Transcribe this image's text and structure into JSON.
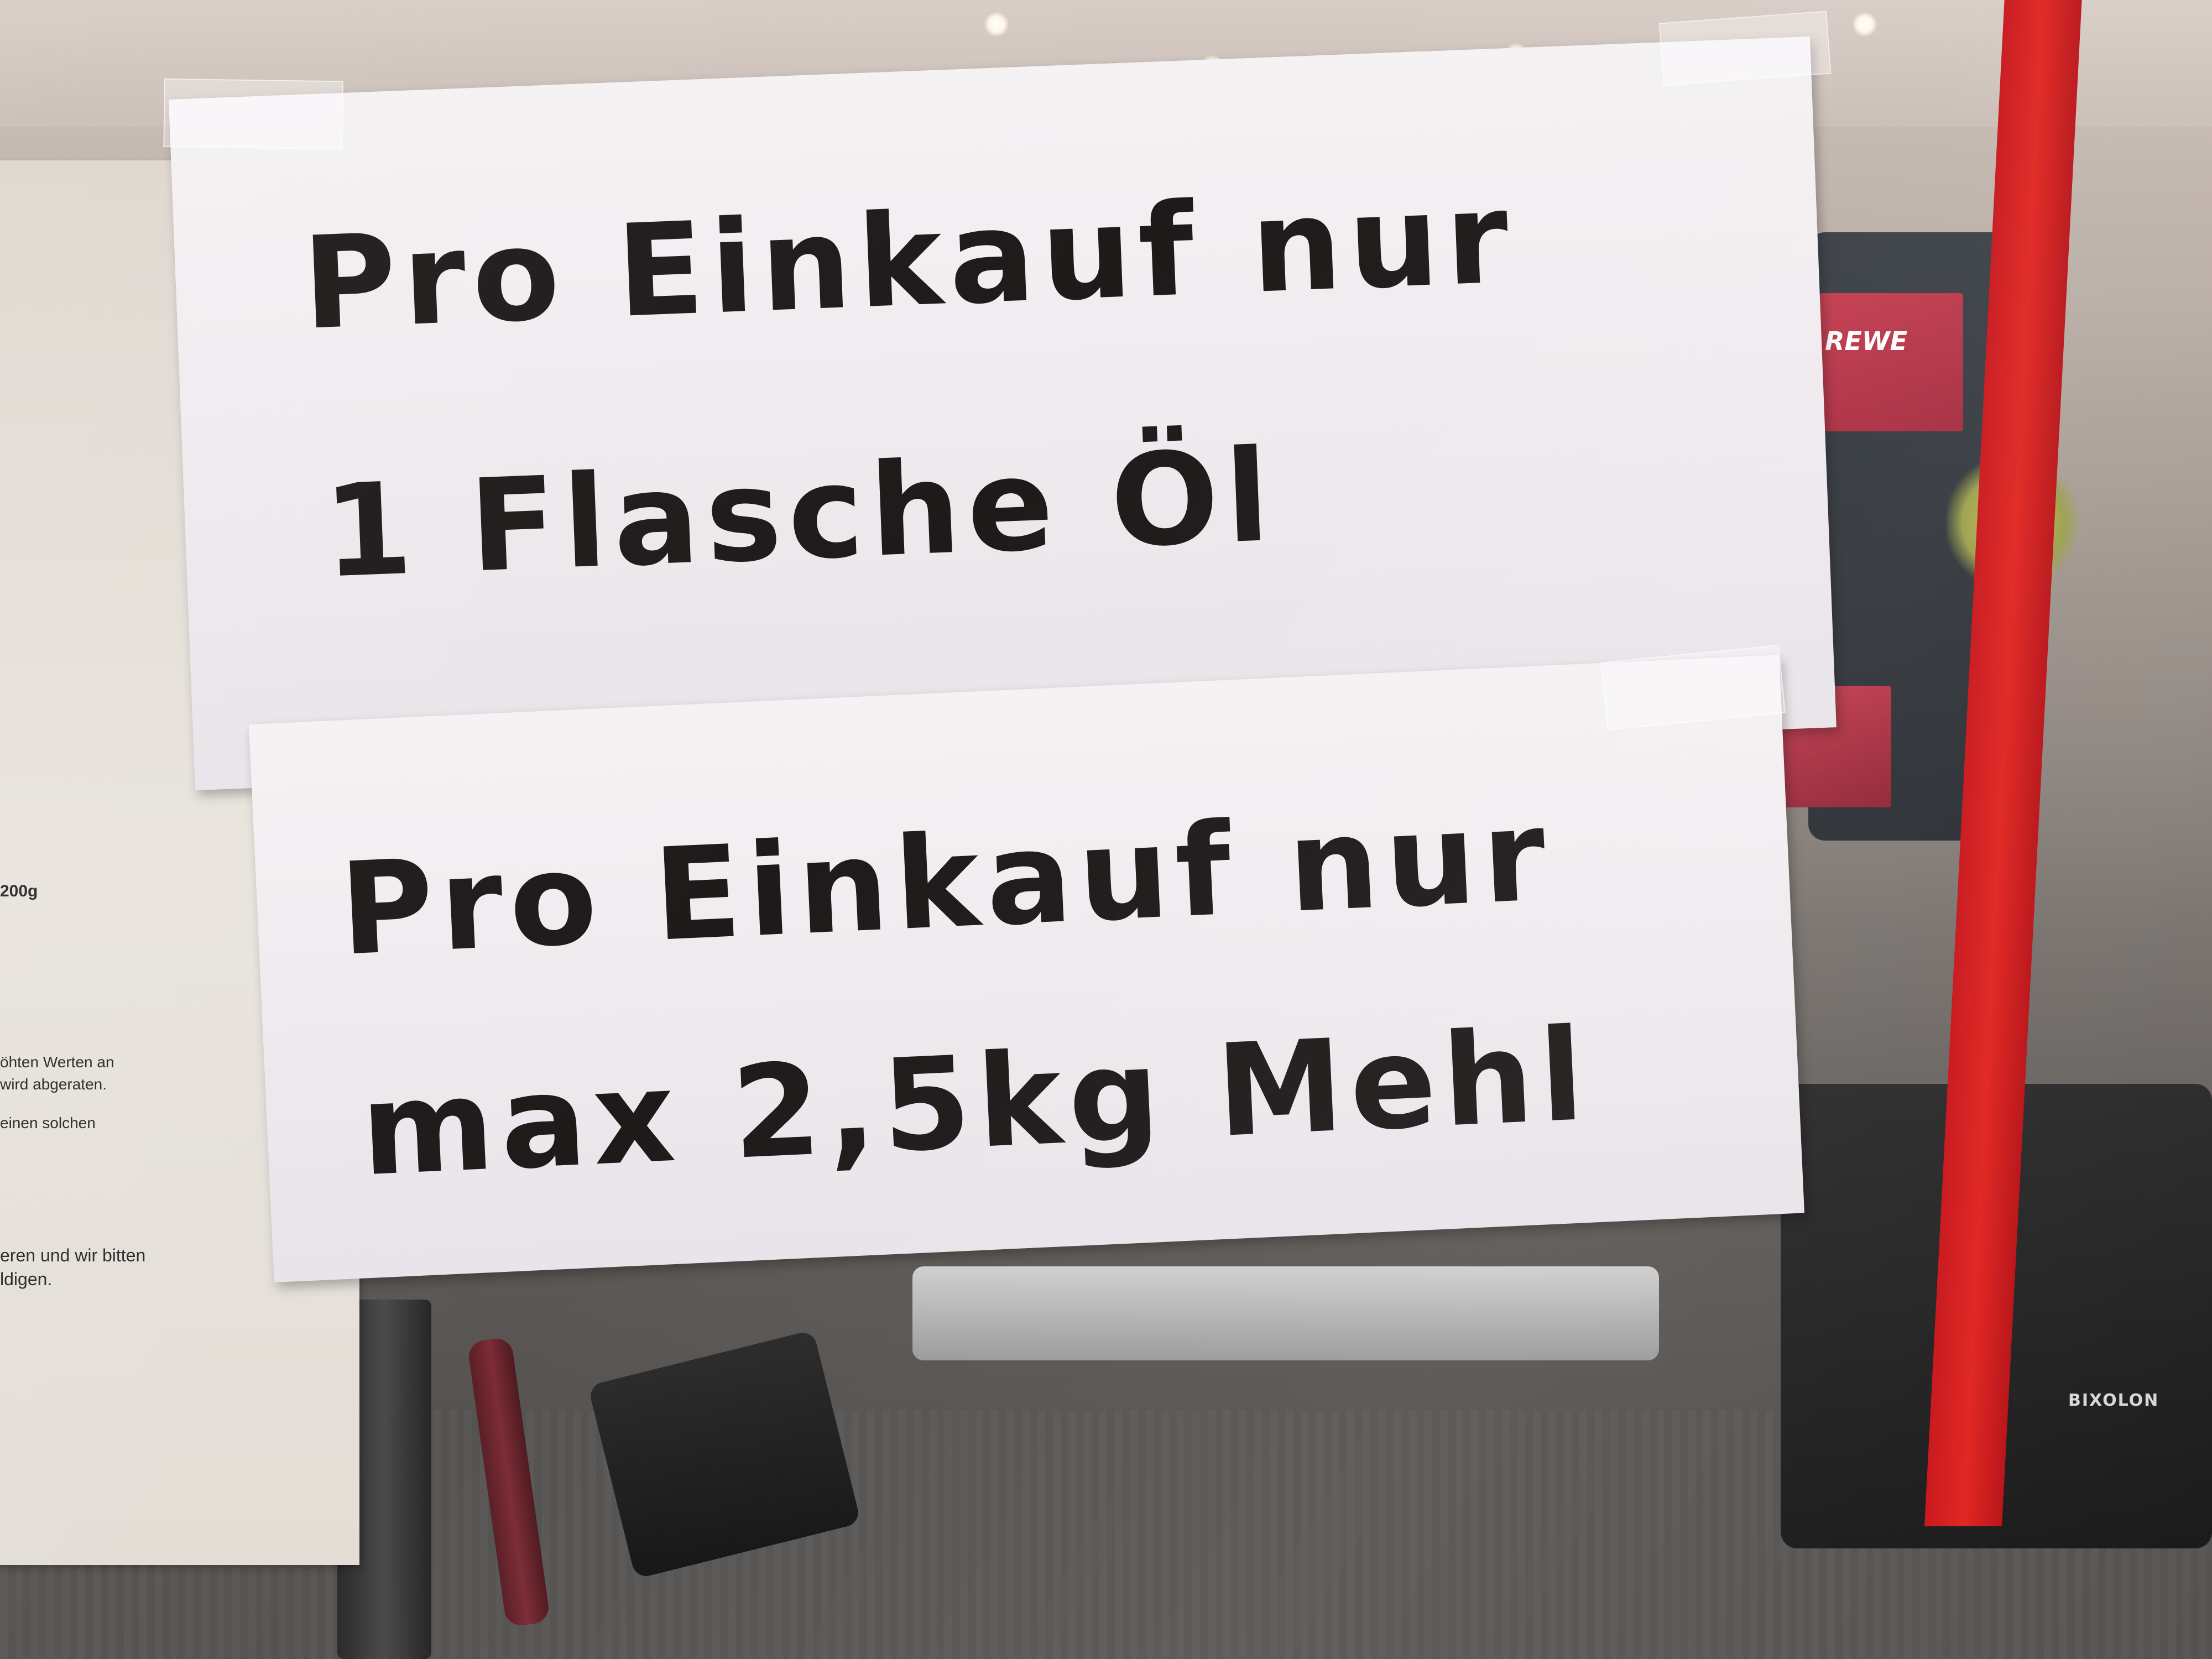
{
  "scene": {
    "description_colors": {
      "sign_paper": "#f2eef1",
      "sign_ink": "#1d1a1a",
      "rail_red": "#e0241f",
      "terminal_red": "#c43c4f"
    }
  },
  "sign_top": {
    "line1": "Pro Einkauf nur",
    "line2": "1 Flasche Öl"
  },
  "sign_bottom": {
    "line1": "Pro Einkauf nur",
    "line2": "max 2,5kg Mehl"
  },
  "left_notice": {
    "lines": [
      "200g",
      "öhten Werten an",
      "wird abgeraten.",
      "einen solchen",
      "eren und wir bitten",
      "ldigen."
    ]
  },
  "background_labels": {
    "terminal_brand": "REWE",
    "printer_brand": "BIXOLON"
  }
}
